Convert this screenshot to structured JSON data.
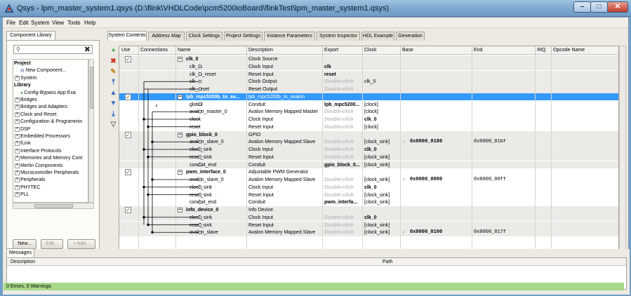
{
  "window": {
    "title": "Qsys - lpm_master_system1.qsys (D:\\flink\\VHDLCode\\pcm5200ioBoard\\flinkTest\\lpm_master_system1.qsys)",
    "controls": [
      "minimize-icon",
      "maximize-icon",
      "close-icon"
    ]
  },
  "menu": [
    "File",
    "Edit",
    "System",
    "View",
    "Tools",
    "Help"
  ],
  "left_tabs": [
    "Component Library"
  ],
  "library": {
    "search_placeholder": "",
    "tree": [
      {
        "label": "Project",
        "bold": true
      },
      {
        "label": "New Component...",
        "italic": true
      },
      {
        "label": "System",
        "pm": "+"
      },
      {
        "label": "Library",
        "bold": true
      },
      {
        "label": "Config-Bypass App Exa"
      },
      {
        "label": "Bridges",
        "pm": "+"
      },
      {
        "label": "Bridges and Adapters",
        "pm": "+"
      },
      {
        "label": "Clock and Reset",
        "pm": "+"
      },
      {
        "label": "Configuration & Programmin",
        "pm": "+"
      },
      {
        "label": "DSP",
        "pm": "+"
      },
      {
        "label": "Embedded Processors",
        "pm": "+"
      },
      {
        "label": "fLink",
        "pm": "+"
      },
      {
        "label": "Interface Protocols",
        "pm": "+"
      },
      {
        "label": "Memories and Memory Cont",
        "pm": "+"
      },
      {
        "label": "Merlin Components",
        "pm": "+"
      },
      {
        "label": "Microcontroller Peripherals",
        "pm": "+"
      },
      {
        "label": "Peripherals",
        "pm": "+"
      },
      {
        "label": "PHYTEC",
        "pm": "+"
      },
      {
        "label": "PLL",
        "pm": "+"
      }
    ],
    "buttons": {
      "new": "New...",
      "edit": "Edit...",
      "add": "+ Add..."
    }
  },
  "main_tabs": [
    "System Contents",
    "Address Map",
    "Clock Settings",
    "Project Settings",
    "Instance Parameters",
    "System Inspector",
    "HDL Example",
    "Generation"
  ],
  "tools": [
    "add-icon",
    "remove-icon",
    "edit-icon",
    "move-top-icon",
    "move-up-icon",
    "move-down-icon",
    "move-bottom-icon",
    "filter-icon"
  ],
  "columns": [
    "Use",
    "Connections",
    "Name",
    "Description",
    "Export",
    "Clock",
    "Base",
    "End",
    "IRQ",
    "Opcode Name"
  ],
  "rows": [
    {
      "use": true,
      "name": "clk_0",
      "desc": "Clock Source",
      "export": "",
      "clock": "",
      "base": "",
      "end": "",
      "group": true,
      "shaded": true
    },
    {
      "name": "clk_in",
      "desc": "Clock Input",
      "export": "clk",
      "clock": "",
      "shaded": true
    },
    {
      "name": "clk_in_reset",
      "desc": "Reset Input",
      "export": "reset",
      "clock": "",
      "shaded": true
    },
    {
      "name": "clk",
      "desc": "Clock Output",
      "export": "Double-click",
      "export_dim": true,
      "clock": "clk_0",
      "shaded": true
    },
    {
      "name": "clk_reset",
      "desc": "Reset Output",
      "export": "Double-click",
      "export_dim": true,
      "clock": "",
      "shaded": true
    },
    {
      "use": true,
      "name": "lpb_mpc5200b_to_av...",
      "desc": "lpb_mpc5200b_to_avalon",
      "export": "",
      "clock": "",
      "group": true,
      "selected": true
    },
    {
      "name": "global",
      "desc": "Conduit",
      "export": "lpb_mpc5200...",
      "clock": "[clock]"
    },
    {
      "name": "avalon_master_0",
      "desc": "Avalon Memory Mapped Master",
      "export": "Double-click",
      "export_dim": true,
      "clock": "[clock]"
    },
    {
      "name": "clock",
      "desc": "Clock Input",
      "export": "Double-click",
      "export_dim": true,
      "clock": "clk_0",
      "clock_bold": true
    },
    {
      "name": "reset",
      "desc": "Reset Input",
      "export": "Double-click",
      "export_dim": true,
      "clock": "[clock]"
    },
    {
      "use": true,
      "name": "gpio_block_0",
      "desc": "GPIO",
      "export": "",
      "clock": "",
      "group": true,
      "shaded": true
    },
    {
      "name": "avalon_slave_0",
      "desc": "Avalon Memory Mapped Slave",
      "export": "Double-click",
      "export_dim": true,
      "clock": "[clock_sink]",
      "base": "0x0000_0180",
      "end": "0x0000_01bf",
      "shaded": true
    },
    {
      "name": "clock_sink",
      "desc": "Clock Input",
      "export": "Double-click",
      "export_dim": true,
      "clock": "clk_0",
      "clock_bold": true,
      "shaded": true
    },
    {
      "name": "reset_sink",
      "desc": "Reset Input",
      "export": "Double-click",
      "export_dim": true,
      "clock": "[clock_sink]",
      "shaded": true
    },
    {
      "name": "conduit_end",
      "desc": "Conduit",
      "export": "gpio_block_0...",
      "clock": "[clock_sink]",
      "shaded": true
    },
    {
      "use": true,
      "name": "pwm_interface_0",
      "desc": "Adjustable PWM Generator",
      "export": "",
      "clock": "",
      "group": true
    },
    {
      "name": "avalon_slave_0",
      "desc": "Avalon Memory Mapped Slave",
      "export": "Double-click",
      "export_dim": true,
      "clock": "[clock_sink]",
      "base": "0x0000_0000",
      "end": "0x0000_00ff"
    },
    {
      "name": "clock_sink",
      "desc": "Clock Input",
      "export": "Double-click",
      "export_dim": true,
      "clock": "clk_0",
      "clock_bold": true
    },
    {
      "name": "reset_sink",
      "desc": "Reset Input",
      "export": "Double-click",
      "export_dim": true,
      "clock": "[clock_sink]"
    },
    {
      "name": "conduit_end",
      "desc": "Conduit",
      "export": "pwm_interfa...",
      "clock": "[clock_sink]"
    },
    {
      "use": true,
      "name": "info_device_0",
      "desc": "Info Device",
      "export": "",
      "clock": "",
      "group": true,
      "shaded": true
    },
    {
      "name": "clock_sink",
      "desc": "Clock Input",
      "export": "Double-click",
      "export_dim": true,
      "clock": "clk_0",
      "clock_bold": true,
      "shaded": true
    },
    {
      "name": "reset_sink",
      "desc": "Reset Input",
      "export": "Double-click",
      "export_dim": true,
      "clock": "[clock_sink]",
      "shaded": true
    },
    {
      "name": "avalon_slave",
      "desc": "Avalon Memory Mapped Slave",
      "export": "Double-click",
      "export_dim": true,
      "clock": "[clock_sink]",
      "base": "0x0000_0100",
      "end": "0x0000_017f",
      "shaded": true
    }
  ],
  "messages": {
    "tab": "Messages",
    "columns": [
      "Description",
      "Path"
    ],
    "status": "0 Errors, 0 Warnings"
  },
  "colors": {
    "selection": "#3399ff",
    "status_ok": "#a8d98a"
  }
}
